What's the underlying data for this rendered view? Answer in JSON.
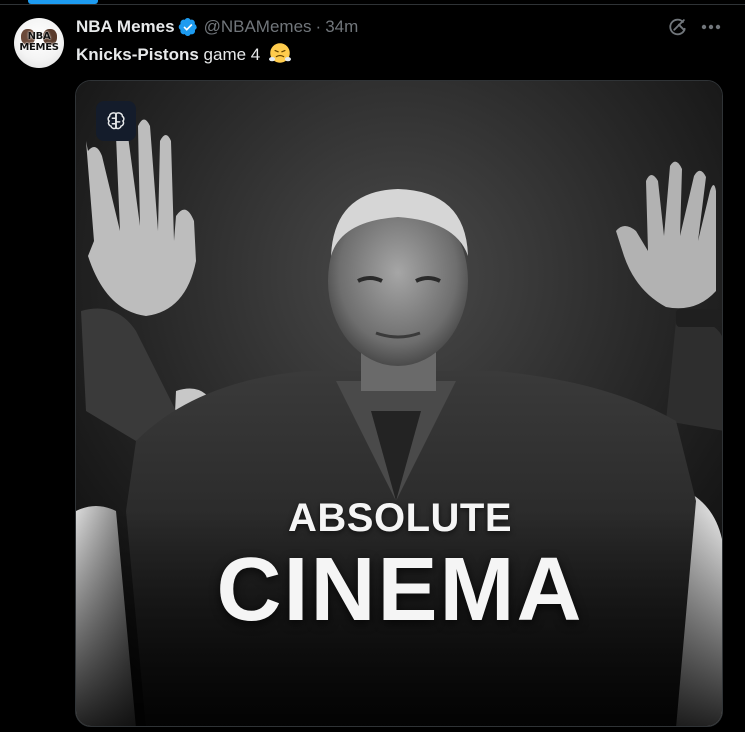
{
  "tweet": {
    "display_name": "NBA Memes",
    "handle": "@NBAMemes",
    "separator": "·",
    "time": "34m",
    "text_bold": "Knicks-Pistons",
    "text_rest": " game 4",
    "emoji": "face-with-steam-from-nose",
    "avatar_text": "NBA MEMES"
  },
  "media": {
    "caption_line1": "ABSOLUTE",
    "caption_line2": "CINEMA",
    "badge_icon": "brain-icon"
  },
  "icons": {
    "verified": "verified-badge-icon",
    "grok": "grok-icon",
    "more": "more-icon"
  },
  "colors": {
    "background": "#000000",
    "accent": "#1d9bf0",
    "text_primary": "#e7e9ea",
    "text_secondary": "#71767b",
    "divider": "#2f3336"
  }
}
